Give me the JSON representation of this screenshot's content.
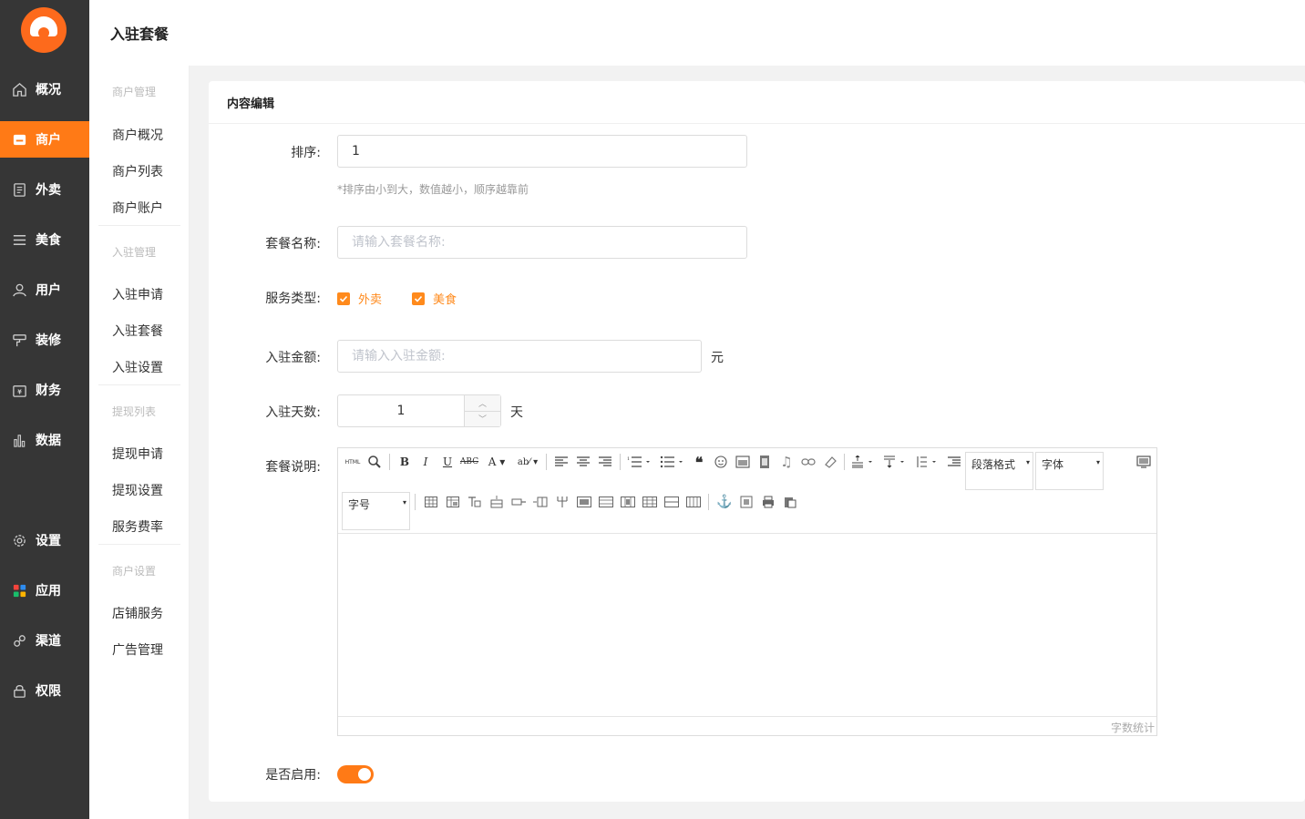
{
  "header": {
    "title": "入驻套餐"
  },
  "sidebar": {
    "items": [
      {
        "label": "概况",
        "icon": "home-icon",
        "active": false
      },
      {
        "label": "商户",
        "icon": "store-icon",
        "active": true
      },
      {
        "label": "外卖",
        "icon": "document-icon",
        "active": false
      },
      {
        "label": "美食",
        "icon": "menu-lines-icon",
        "active": false
      },
      {
        "label": "用户",
        "icon": "user-icon",
        "active": false
      },
      {
        "label": "装修",
        "icon": "paint-roller-icon",
        "active": false
      },
      {
        "label": "财务",
        "icon": "wallet-icon",
        "active": false
      },
      {
        "label": "数据",
        "icon": "bar-chart-icon",
        "active": false
      },
      {
        "label": "设置",
        "icon": "gear-icon",
        "active": false
      },
      {
        "label": "应用",
        "icon": "apps-grid-icon",
        "active": false
      },
      {
        "label": "渠道",
        "icon": "link-icon",
        "active": false
      },
      {
        "label": "权限",
        "icon": "lock-icon",
        "active": false
      }
    ]
  },
  "subnav": {
    "groups": [
      {
        "title": "商户管理",
        "items": [
          "商户概况",
          "商户列表",
          "商户账户"
        ]
      },
      {
        "title": "入驻管理",
        "items": [
          "入驻申请",
          "入驻套餐",
          "入驻设置"
        ]
      },
      {
        "title": "提现列表",
        "items": [
          "提现申请",
          "提现设置",
          "服务费率"
        ]
      },
      {
        "title": "商户设置",
        "items": [
          "店铺服务",
          "广告管理"
        ]
      }
    ]
  },
  "card": {
    "title": "内容编辑"
  },
  "form": {
    "sort": {
      "label": "排序:",
      "value": "1",
      "hint": "*排序由小到大，数值越小，顺序越靠前"
    },
    "name": {
      "label": "套餐名称:",
      "placeholder": "请输入套餐名称:"
    },
    "service_type": {
      "label": "服务类型:",
      "options": [
        {
          "label": "外卖",
          "checked": true
        },
        {
          "label": "美食",
          "checked": true
        }
      ]
    },
    "amount": {
      "label": "入驻金额:",
      "placeholder": "请输入入驻金额:",
      "unit": "元"
    },
    "days": {
      "label": "入驻天数:",
      "value": "1",
      "unit": "天"
    },
    "description": {
      "label": "套餐说明:"
    },
    "enabled": {
      "label": "是否启用:",
      "on": true
    }
  },
  "editor": {
    "html_label": "HTML",
    "paragraph_format": "段落格式",
    "font_family": "字体",
    "font_size": "字号",
    "word_count": "字数统计"
  },
  "colors": {
    "accent": "#ff7a16",
    "sidebar_bg": "#363636"
  }
}
